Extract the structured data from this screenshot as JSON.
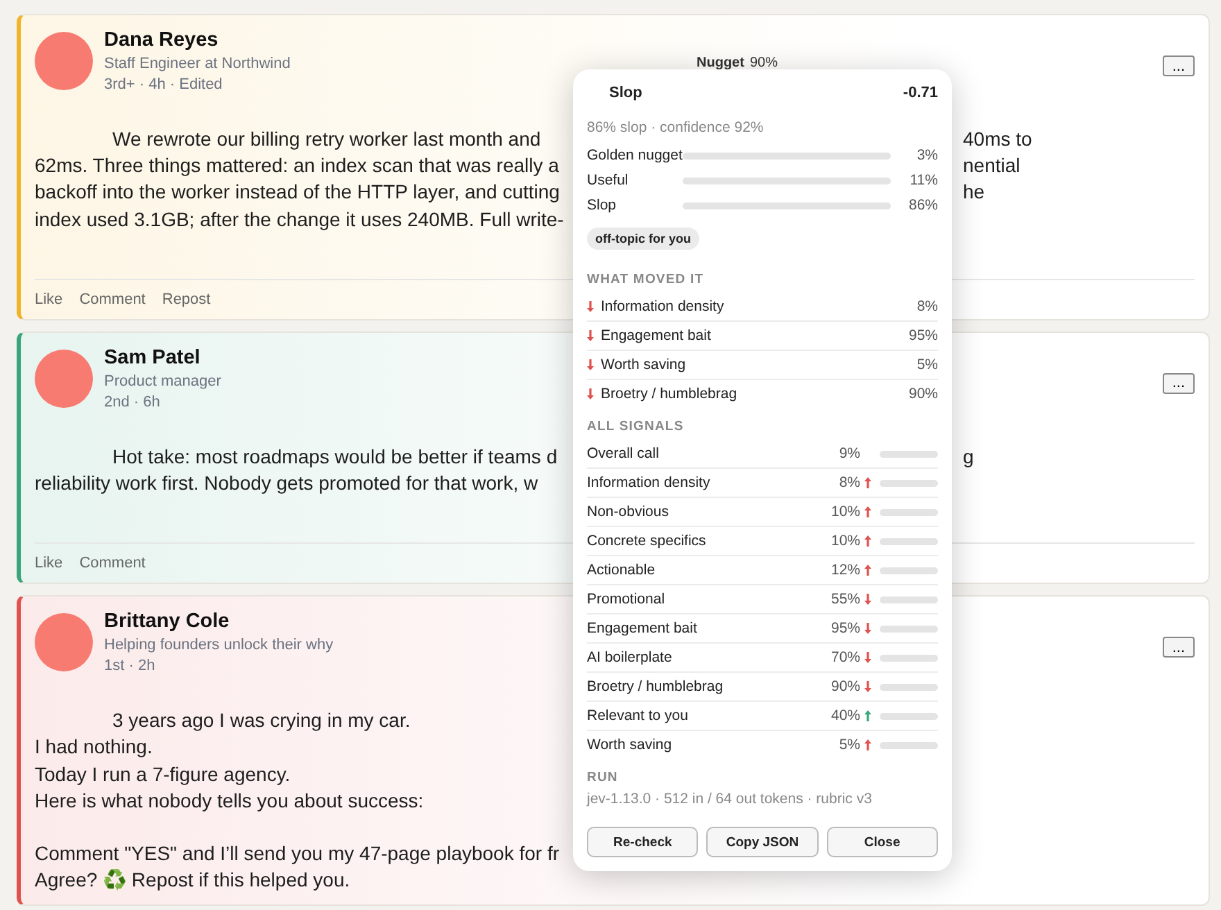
{
  "posts": [
    {
      "author": "Dana Reyes",
      "headline": "Staff Engineer at Northwind",
      "meta": "3rd+ · 4h · Edited",
      "color": "#f0b429",
      "badge": {
        "label": "Nugget",
        "value": "90%"
      },
      "menu": "...",
      "body": [
        {
          "lines": [
            {
              "text": "We rewrote our billing retry worker last month and",
              "right": "40ms to"
            },
            {
              "text": "62ms. Three things mattered: an index scan that was really a",
              "right": "nential"
            },
            {
              "text": "backoff into the worker instead of the HTTP layer, and cutting",
              "right": "he"
            },
            {
              "text": "index used 3.1GB; after the change it uses 240MB. Full write-"
            }
          ]
        }
      ],
      "actions": [
        "Like",
        "Comment",
        "Repost"
      ]
    },
    {
      "author": "Sam Patel",
      "headline": "Product manager",
      "meta": "2nd · 6h",
      "color": "#3aa57a",
      "menu": "...",
      "body": [
        {
          "lines": [
            {
              "text": "Hot take: most roadmaps would be better if teams d",
              "right": "g"
            },
            {
              "text": "reliability work first. Nobody gets promoted for that work, w"
            }
          ]
        }
      ],
      "actions": [
        "Like",
        "Comment"
      ]
    },
    {
      "author": "Brittany Cole",
      "headline": "Helping founders unlock their why",
      "meta": "1st · 2h",
      "color": "#e0524f",
      "menu": "...",
      "body": [
        {
          "lines": [
            {
              "text": "3 years ago I was crying in my car."
            },
            {
              "text": "I had nothing."
            },
            {
              "text": "Today I run a 7-figure agency."
            },
            {
              "text": "Here is what nobody tells you about success:"
            }
          ]
        },
        {
          "lines": [
            {
              "text": "Comment \"YES\" and I’ll send you my 47-page playbook for fr"
            },
            {
              "text": "Agree? ♻️ Repost if this helped you."
            }
          ]
        }
      ]
    }
  ],
  "popover": {
    "title": "Slop",
    "score": "-0.71",
    "summary": "86% slop · confidence 92%",
    "bars": [
      {
        "label": "Golden nugget",
        "value": "3%"
      },
      {
        "label": "Useful",
        "value": "11%"
      },
      {
        "label": "Slop",
        "value": "86%"
      }
    ],
    "tag": "off-topic for you",
    "moved": {
      "heading": "WHAT MOVED IT",
      "items": [
        {
          "label": "Information density",
          "value": "8%",
          "kind": "down",
          "color": "#e0524f"
        },
        {
          "label": "Engagement bait",
          "value": "95%",
          "kind": "down",
          "color": "#e0524f"
        },
        {
          "label": "Worth saving",
          "value": "5%",
          "kind": "down",
          "color": "#e0524f"
        },
        {
          "label": "Broetry / humblebrag",
          "value": "90%",
          "kind": "down",
          "color": "#e0524f"
        }
      ]
    },
    "signals": {
      "heading": "ALL SIGNALS",
      "items": [
        {
          "label": "Overall call",
          "value": "9%",
          "kind": "plain"
        },
        {
          "label": "Information density",
          "value": "8%",
          "kind": "up",
          "color": "#e0524f"
        },
        {
          "label": "Non-obvious",
          "value": "10%",
          "kind": "up",
          "color": "#e0524f"
        },
        {
          "label": "Concrete specifics",
          "value": "10%",
          "kind": "up",
          "color": "#e0524f"
        },
        {
          "label": "Actionable",
          "value": "12%",
          "kind": "up",
          "color": "#e0524f"
        },
        {
          "label": "Promotional",
          "value": "55%",
          "kind": "down",
          "color": "#e0524f"
        },
        {
          "label": "Engagement bait",
          "value": "95%",
          "kind": "down",
          "color": "#e0524f"
        },
        {
          "label": "AI boilerplate",
          "value": "70%",
          "kind": "down",
          "color": "#e0524f"
        },
        {
          "label": "Broetry / humblebrag",
          "value": "90%",
          "kind": "down",
          "color": "#e0524f"
        },
        {
          "label": "Relevant to you",
          "value": "40%",
          "kind": "up",
          "color": "#3aa57a"
        },
        {
          "label": "Worth saving",
          "value": "5%",
          "kind": "up",
          "color": "#e0524f"
        }
      ]
    },
    "run": {
      "heading": "RUN",
      "text": "jev-1.13.0 · 512 in / 64 out tokens · rubric v3"
    },
    "buttons": [
      "Re-check",
      "Copy JSON",
      "Close"
    ]
  }
}
